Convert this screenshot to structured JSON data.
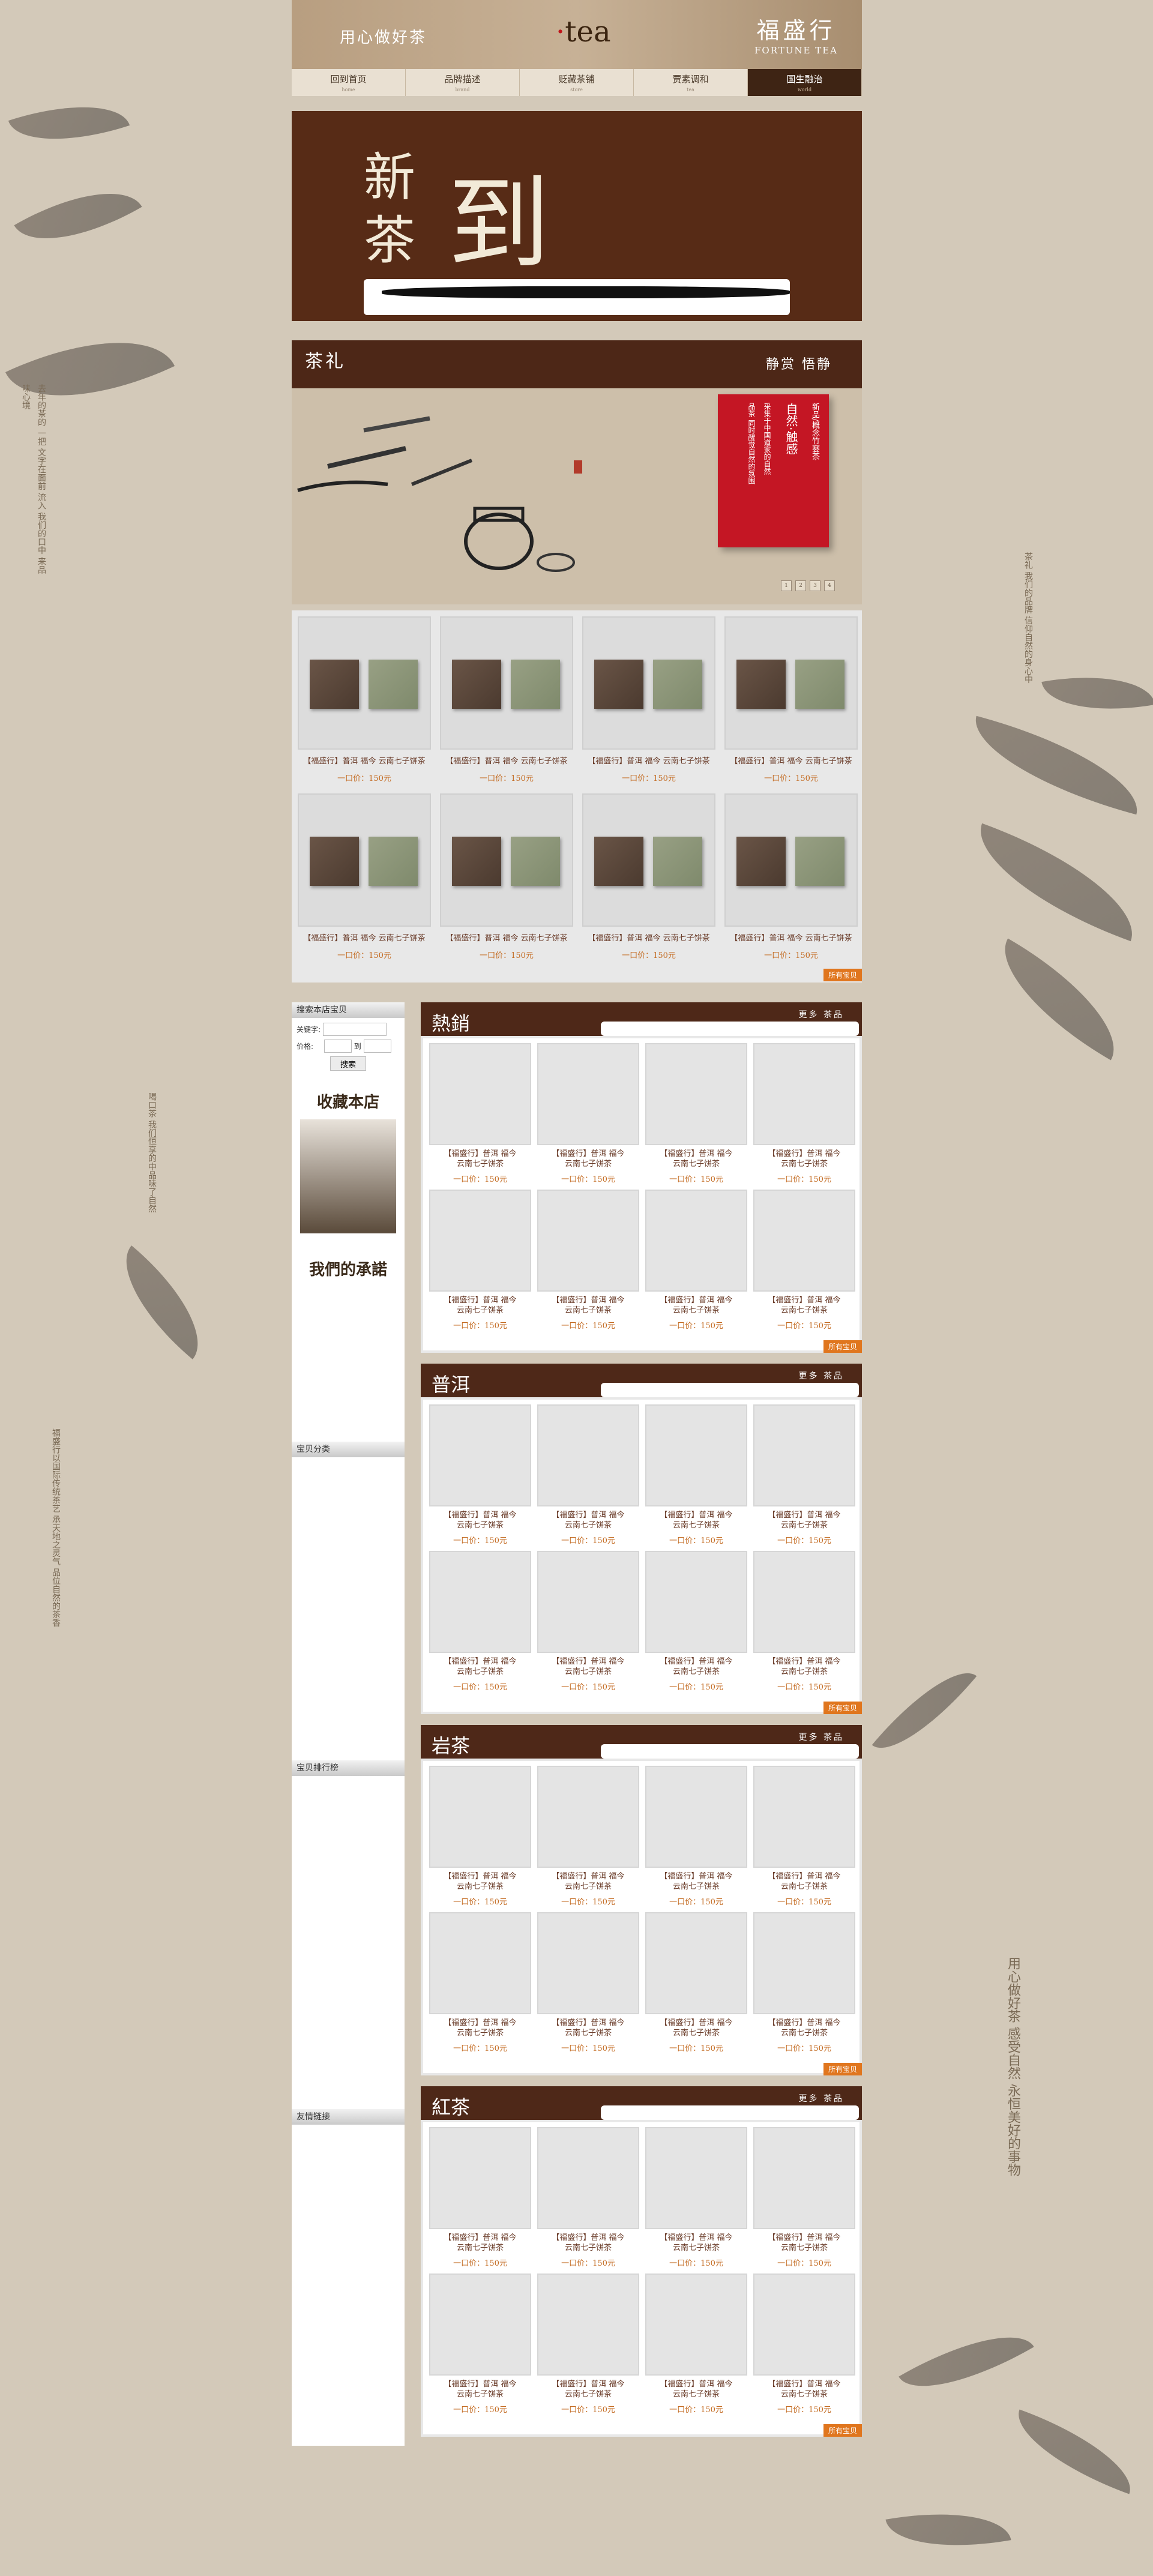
{
  "header": {
    "slogan": "用心做好茶",
    "logo_text": "tea",
    "brand_cn": "福盛行",
    "brand_en": "FORTUNE TEA"
  },
  "nav": [
    {
      "label": "回到首页",
      "sub": "home"
    },
    {
      "label": "品牌描述",
      "sub": "brand"
    },
    {
      "label": "贬藏茶铺",
      "sub": "store"
    },
    {
      "label": "贾素调和",
      "sub": "tea"
    },
    {
      "label": "国生融治",
      "sub": "world"
    }
  ],
  "banner": {
    "chars": [
      "新",
      "茶",
      "到"
    ]
  },
  "gift": {
    "title": "茶礼",
    "right": "静赏 悟静",
    "red_lines": [
      "新品/概念竹窭茶",
      "自然·触感",
      "采集于中国道家的自然",
      "品茶 同时醒觉自然的氛围"
    ],
    "pages": [
      "1",
      "2",
      "3",
      "4"
    ]
  },
  "grid_products": {
    "title": "【福盛行】普洱 福今 云南七子饼茶",
    "price": "一口价：150元",
    "count": 8,
    "more": "所有宝贝"
  },
  "sidebar": {
    "search_head": "搜索本店宝贝",
    "keyword_label": "关键字:",
    "price_label": "价格:",
    "to_label": "到",
    "search_button": "搜索",
    "favorite": "收藏本店",
    "promise": "我們的承諾",
    "categories": "宝贝分类",
    "ranking": "宝贝排行榜",
    "links": "友情链接"
  },
  "sections": [
    {
      "title": "熱銷",
      "links": "更多 茶品"
    },
    {
      "title": "普洱",
      "links": "更多 茶品"
    },
    {
      "title": "岩茶",
      "links": "更多 茶品"
    },
    {
      "title": "紅茶",
      "links": "更多 茶品"
    }
  ],
  "section_product": {
    "line1": "【福盛行】普洱 福今",
    "line2": "云南七子饼茶",
    "price": "一口价：150元"
  },
  "decor": {
    "left_text_1": "去年的茶的 一把 文字在面前 流入 我们的口中 来品味心境",
    "left_text_2": "喝口茶 我们恒享的中品味了自然",
    "left_text_3": "福盛行以国际传统茶艺 承天地之灵气 品位自然的茶香",
    "right_text_1": "茶礼 我们的品牌 信仰自然的身心中",
    "right_text_2": "用心做好茶 感受自然 永恒美好的事物"
  }
}
